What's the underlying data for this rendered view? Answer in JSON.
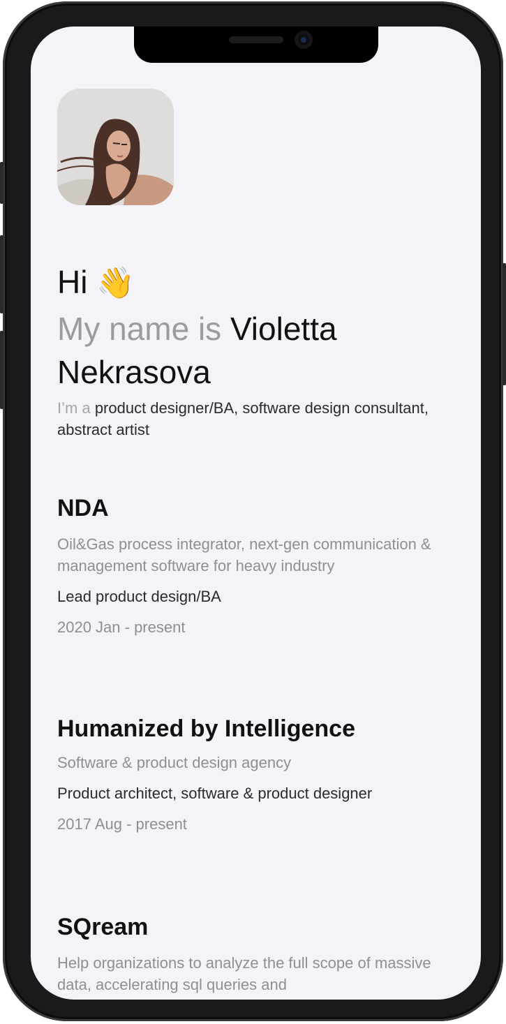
{
  "intro": {
    "greeting": "Hi",
    "wave_icon": "👋",
    "name_prefix": "My name is",
    "name": "Violetta Nekrasova",
    "role_prefix": "I’m a",
    "role_text": "product designer/BA, software design consultant, abstract artist"
  },
  "jobs": [
    {
      "company": "NDA",
      "description": "Oil&Gas process integrator, next-gen communication & management software for heavy industry",
      "role": "Lead product design/BA",
      "dates": "2020 Jan - present"
    },
    {
      "company": "Humanized by Intelligence",
      "description": "Software & product design agency",
      "role": "Product architect, software & product designer",
      "dates": "2017 Aug - present"
    },
    {
      "company": "SQream",
      "description": "Help organizations to analyze the full scope of massive data, accelerating sql queries and"
    }
  ]
}
